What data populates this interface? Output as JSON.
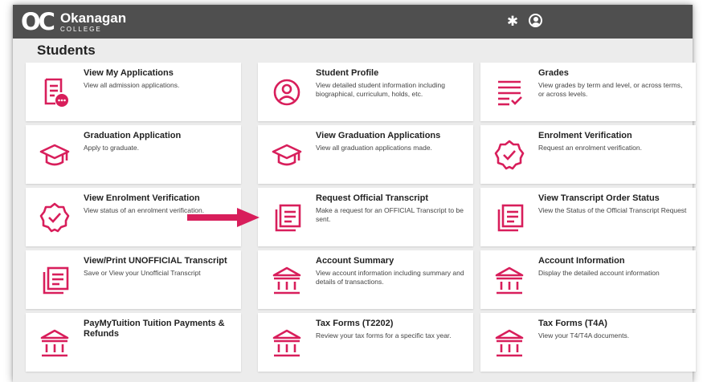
{
  "header": {
    "logo_mark": "OC",
    "logo_name": "Okanagan",
    "logo_sub": "COLLEGE"
  },
  "page": {
    "title": "Students"
  },
  "tiles": [
    {
      "title": "View My Applications",
      "description": "View all admission applications.",
      "icon": "application-list-icon"
    },
    {
      "title": "Student Profile",
      "description": "View detailed student information including biographical, curriculum, holds, etc.",
      "icon": "user-profile-icon"
    },
    {
      "title": "Grades",
      "description": "View grades by term and level, or across terms, or across levels.",
      "icon": "grades-list-icon"
    },
    {
      "title": "Graduation Application",
      "description": "Apply to graduate.",
      "icon": "graduation-cap-icon"
    },
    {
      "title": "View Graduation Applications",
      "description": "View all graduation applications made.",
      "icon": "graduation-cap-icon"
    },
    {
      "title": "Enrolment Verification",
      "description": "Request an enrolment verification.",
      "icon": "verified-badge-icon"
    },
    {
      "title": "View Enrolment Verification",
      "description": "View status of an enrolment verification.",
      "icon": "verified-badge-icon"
    },
    {
      "title": "Request Official Transcript",
      "description": "Make a request for an OFFICIAL Transcript to be sent.",
      "icon": "transcript-icon"
    },
    {
      "title": "View Transcript Order Status",
      "description": "View the Status of the Official Transcript Request",
      "icon": "transcript-icon"
    },
    {
      "title": "View/Print UNOFFICIAL Transcript",
      "description": "Save or View your Unofficial Transcript",
      "icon": "transcript-icon"
    },
    {
      "title": "Account Summary",
      "description": "View account information including summary and details of transactions.",
      "icon": "bank-icon"
    },
    {
      "title": "Account Information",
      "description": "Display the detailed account information",
      "icon": "bank-icon"
    },
    {
      "title": "PayMyTuition Tuition Payments & Refunds",
      "description": "",
      "icon": "bank-icon"
    },
    {
      "title": "Tax Forms (T2202)",
      "description": "Review your tax forms for a specific tax year.",
      "icon": "bank-icon"
    },
    {
      "title": "Tax Forms (T4A)",
      "description": "View your T4/T4A documents.",
      "icon": "bank-icon"
    }
  ],
  "colors": {
    "accent": "#d81e5b",
    "topbar": "#4f4f4f",
    "background": "#ececec"
  },
  "annotation": {
    "arrow": "pointer-arrow-icon"
  }
}
